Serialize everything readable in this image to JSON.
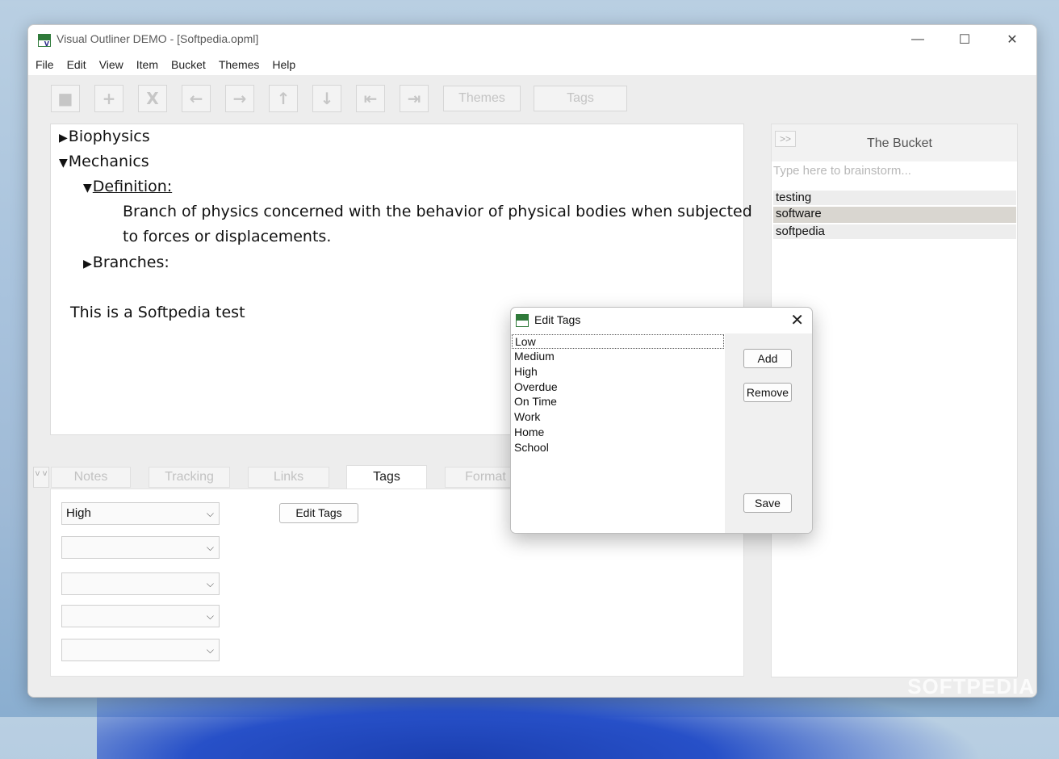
{
  "window": {
    "title": "Visual Outliner DEMO  -  [Softpedia.opml]"
  },
  "window_controls": {
    "minimize": "—",
    "maximize": "☐",
    "close": "✕"
  },
  "menu": [
    "File",
    "Edit",
    "View",
    "Item",
    "Bucket",
    "Themes",
    "Help"
  ],
  "toolbar": {
    "buttons": [
      {
        "name": "stop-icon",
        "glyph": "■"
      },
      {
        "name": "add-icon",
        "glyph": "+"
      },
      {
        "name": "delete-icon",
        "glyph": "X"
      },
      {
        "name": "arrow-left-icon",
        "glyph": "←"
      },
      {
        "name": "arrow-right-icon",
        "glyph": "→"
      },
      {
        "name": "arrow-up-icon",
        "glyph": "↑"
      },
      {
        "name": "arrow-down-icon",
        "glyph": "↓"
      },
      {
        "name": "collapse-left-icon",
        "glyph": "⇤"
      },
      {
        "name": "expand-right-icon",
        "glyph": "⇥"
      }
    ],
    "themes_label": "Themes",
    "tags_label": "Tags"
  },
  "outline": {
    "items": [
      {
        "triangle": "▶",
        "text": "Biophysics"
      },
      {
        "triangle": "▼",
        "text": "Mechanics"
      },
      {
        "triangle": "▼",
        "text": "Definition:"
      },
      {
        "text": "Branch of physics concerned with the behavior of physical bodies when subjected"
      },
      {
        "text": "to forces or displacements."
      },
      {
        "triangle": "▶",
        "text": "Branches:"
      },
      {
        "text": "This is a Softpedia test"
      }
    ]
  },
  "tabs": {
    "toggle": "v v",
    "items": [
      "Notes",
      "Tracking",
      "Links",
      "Tags",
      "Format"
    ],
    "active": "Tags"
  },
  "tags_panel": {
    "selects": [
      "High",
      "",
      "",
      "",
      ""
    ],
    "chevron": "⌵",
    "edit_tags_label": "Edit Tags"
  },
  "bucket": {
    "toggle": ">>",
    "title": "The Bucket",
    "placeholder": "Type here to brainstorm...",
    "items": [
      "testing",
      "software",
      "softpedia"
    ],
    "selected": "software"
  },
  "dialog": {
    "title": "Edit Tags",
    "close": "✕",
    "items": [
      "Low",
      "Medium",
      "High",
      "Overdue",
      "On Time",
      "Work",
      "Home",
      "School"
    ],
    "add_label": "Add",
    "remove_label": "Remove",
    "save_label": "Save"
  },
  "watermark": "SOFTPEDIA"
}
